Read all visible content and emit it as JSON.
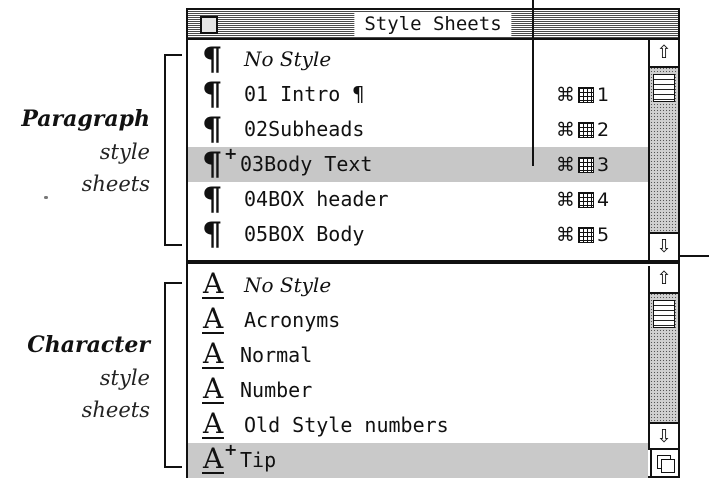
{
  "window": {
    "title": "Style Sheets"
  },
  "annotations": {
    "paragraph": {
      "heading": "Paragraph",
      "line2": "style",
      "line3": "sheets"
    },
    "character": {
      "heading": "Character",
      "line2": "style",
      "line3": "sheets"
    }
  },
  "paragraph_styles": [
    {
      "name": "No Style",
      "glyph": "¶",
      "plus": "",
      "shortcut": ""
    },
    {
      "name": "01 Intro ¶",
      "glyph": "¶",
      "plus": "",
      "shortcut": "1",
      "cmd": "⌘"
    },
    {
      "name": "02Subheads",
      "glyph": "¶",
      "plus": "",
      "shortcut": "2",
      "cmd": "⌘"
    },
    {
      "name": "03Body Text",
      "glyph": "¶",
      "plus": "+",
      "shortcut": "3",
      "cmd": "⌘",
      "selected": true
    },
    {
      "name": "04BOX header",
      "glyph": "¶",
      "plus": "",
      "shortcut": "4",
      "cmd": "⌘"
    },
    {
      "name": "05BOX Body",
      "glyph": "¶",
      "plus": "",
      "shortcut": "5",
      "cmd": "⌘"
    }
  ],
  "character_styles": [
    {
      "name": "No Style",
      "glyph": "A",
      "plus": ""
    },
    {
      "name": "Acronyms",
      "glyph": "A",
      "plus": ""
    },
    {
      "name": "Normal",
      "glyph": "A",
      "plus": ""
    },
    {
      "name": "Number",
      "glyph": "A",
      "plus": ""
    },
    {
      "name": "Old Style numbers",
      "glyph": "A",
      "plus": ""
    },
    {
      "name": "Tip",
      "glyph": "A",
      "plus": "+",
      "selected": true
    }
  ],
  "scroll": {
    "up_arrow": "⇧",
    "down_arrow": "⇩"
  },
  "icons": {
    "close": "close-box-icon",
    "paragraph_style": "pilcrow-icon",
    "character_style": "underlined-a-icon",
    "command_key": "command-key-icon",
    "keypad_key": "keypad-key-icon",
    "grow": "grow-box-icon"
  }
}
